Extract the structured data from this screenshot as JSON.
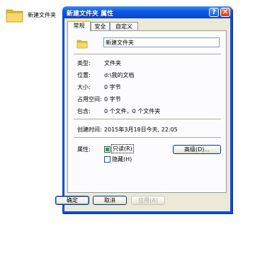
{
  "desktop": {
    "icon_label": "新建文件夹"
  },
  "window": {
    "title": "新建文件夹 属性",
    "help_glyph": "?",
    "close_glyph": "✕"
  },
  "tabs": [
    {
      "label": "常规"
    },
    {
      "label": "安全"
    },
    {
      "label": "自定义"
    }
  ],
  "general": {
    "name_value": "新建文件夹",
    "rows": [
      {
        "label": "类型:",
        "value": "文件夹"
      },
      {
        "label": "位置:",
        "value": "d:\\我的文档"
      },
      {
        "label": "大小:",
        "value": "0 字节"
      },
      {
        "label": "占用空间:",
        "value": "0 字节"
      },
      {
        "label": "包含:",
        "value": "0 个文件，0 个文件夹"
      }
    ],
    "created": {
      "label": "创建时间:",
      "value": "2015年3月18日今天, 22:05"
    },
    "attributes": {
      "label": "属性:",
      "readonly": {
        "label": "只读(R)",
        "checked": true
      },
      "hidden": {
        "label": "隐藏(H)",
        "checked": false
      },
      "advanced_button": "高级(D)..."
    }
  },
  "buttons": {
    "ok": "确定",
    "cancel": "取消",
    "apply": "应用(A)"
  },
  "colors": {
    "titlebar": "#0a4fd8",
    "dialog_bg": "#ece9d8",
    "panel_bg": "#fcfcfe",
    "folder": "#f5d76e"
  }
}
